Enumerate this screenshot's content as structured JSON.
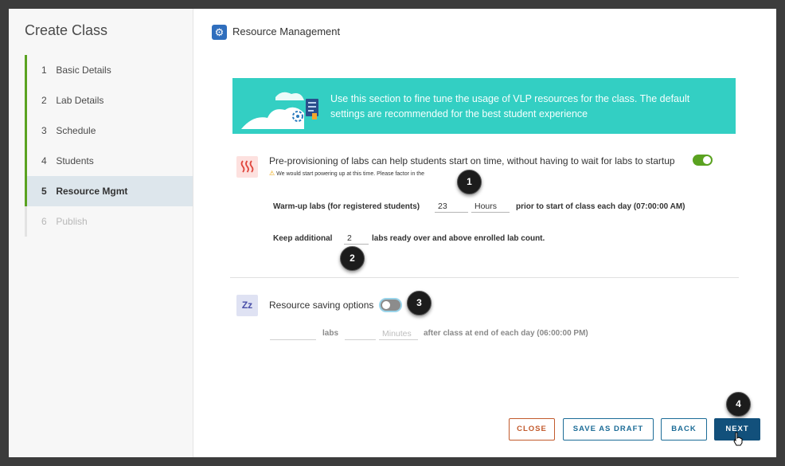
{
  "dialog": {
    "title": "Create Class",
    "steps": [
      {
        "num": "1",
        "label": "Basic Details",
        "state": "done"
      },
      {
        "num": "2",
        "label": "Lab Details",
        "state": "done"
      },
      {
        "num": "3",
        "label": "Schedule",
        "state": "done"
      },
      {
        "num": "4",
        "label": "Students",
        "state": "done"
      },
      {
        "num": "5",
        "label": "Resource Mgmt",
        "state": "active"
      },
      {
        "num": "6",
        "label": "Publish",
        "state": "disabled"
      }
    ]
  },
  "header": {
    "title": "Resource Management",
    "icon": "gear-icon"
  },
  "banner": {
    "text": "Use this section to fine tune the usage of VLP resources for the class. The default settings are recommended for the best student experience",
    "color": "#33cfc3"
  },
  "preprov": {
    "label": "Pre-provisioning of labs can help students start on time, without having to wait for labs to startup",
    "enabled": true,
    "warning": "We would start powering up at this time. Please factor in the",
    "warmup_label": "Warm-up labs (for registered students)",
    "warmup_value": "23",
    "warmup_unit": "Hours",
    "warmup_suffix": "prior to start of class each day (07:00:00 AM)",
    "keep_label": "Keep additional",
    "keep_value": "2",
    "keep_suffix": "labs ready over and above enrolled lab count."
  },
  "saving": {
    "label": "Resource saving options",
    "enabled": false,
    "labs_label": "labs",
    "minutes_placeholder": "Minutes",
    "suffix": "after class at end of each day (06:00:00 PM)"
  },
  "callouts": [
    "1",
    "2",
    "3",
    "4"
  ],
  "buttons": {
    "close": "CLOSE",
    "save_draft": "SAVE AS DRAFT",
    "back": "BACK",
    "next": "NEXT"
  },
  "colors": {
    "accent_green": "#5aa220",
    "primary_blue": "#12507b",
    "close_orange": "#c25a2c"
  }
}
